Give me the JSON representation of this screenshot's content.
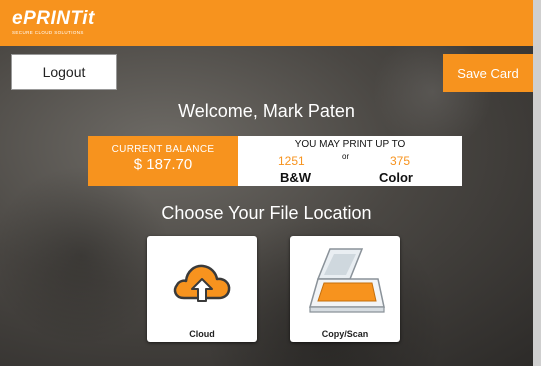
{
  "header": {
    "logo_main": "ePRINTit",
    "logo_tagline": "SECURE CLOUD SOLUTIONS",
    "brand_color": "#f7931e"
  },
  "actions": {
    "logout_label": "Logout",
    "save_card_label": "Save Card"
  },
  "welcome": {
    "text": "Welcome, Mark Paten"
  },
  "balance": {
    "label": "CURRENT BALANCE",
    "value": "$ 187.70",
    "print_up_to": "YOU MAY PRINT UP TO",
    "or": "or",
    "bw_count": "1251",
    "bw_label": "B&W",
    "color_count": "375",
    "color_label": "Color"
  },
  "file_location": {
    "title": "Choose Your File Location",
    "options": [
      {
        "label": "Cloud",
        "icon": "cloud-upload-icon"
      },
      {
        "label": "Copy/Scan",
        "icon": "scanner-icon"
      }
    ]
  }
}
